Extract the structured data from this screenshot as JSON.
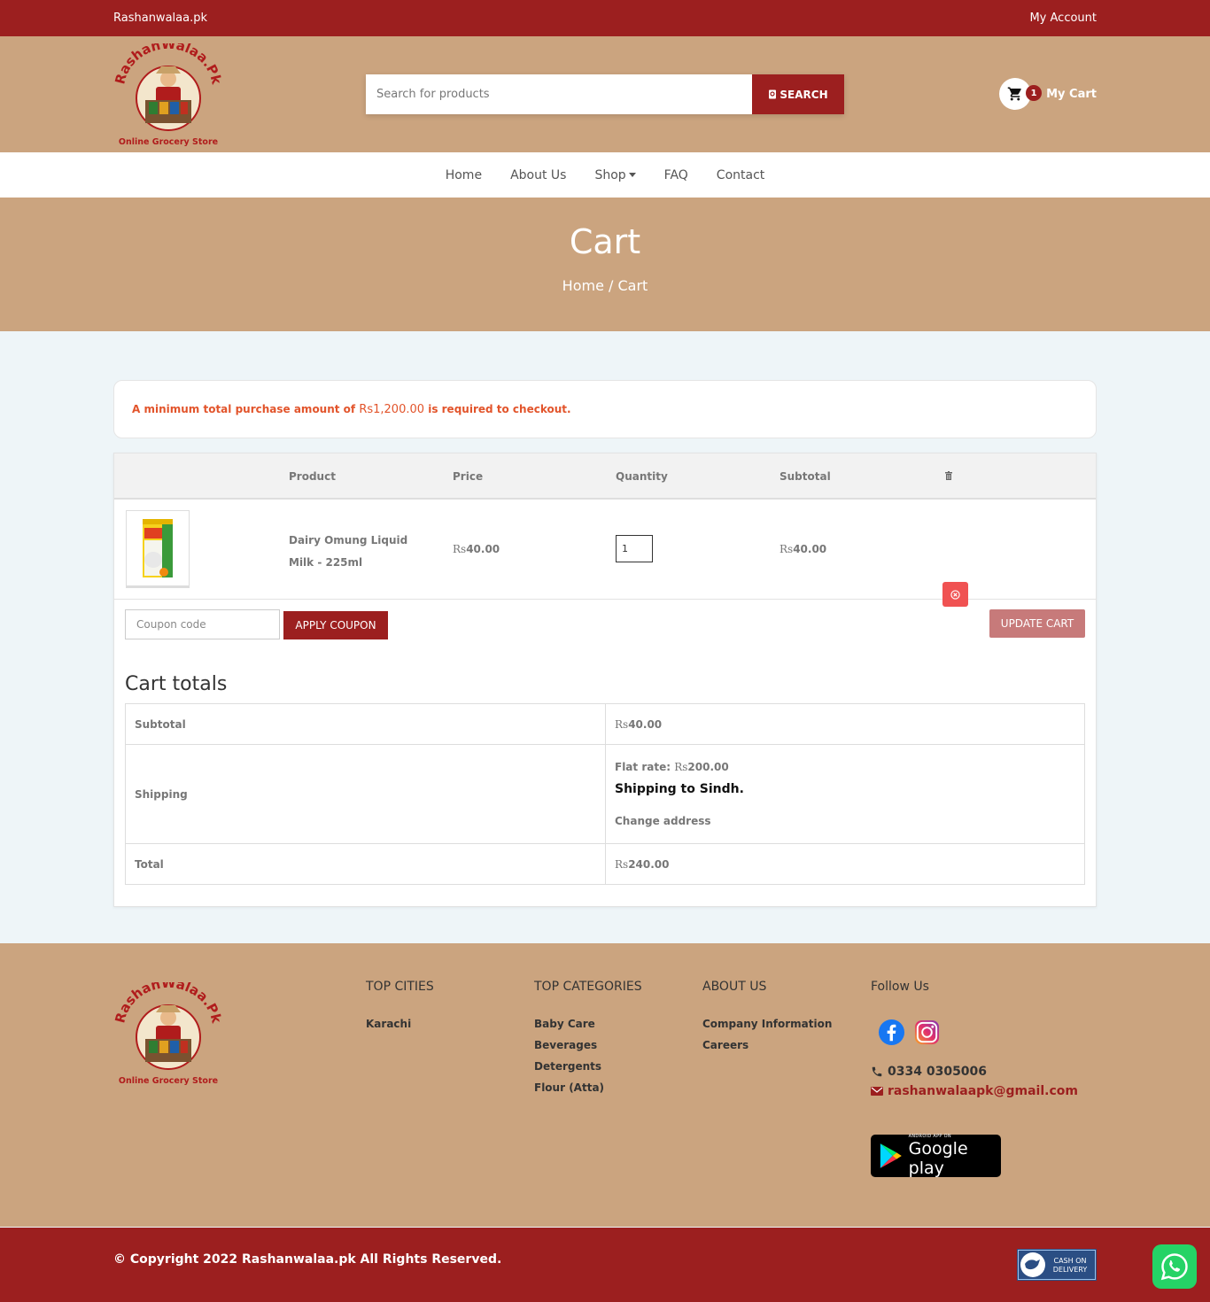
{
  "topbar": {
    "site": "Rashanwalaa.pk",
    "account": "My Account"
  },
  "logo": {
    "text": "RashanWalaa.Pk",
    "tagline": "Online Grocery Store"
  },
  "search": {
    "placeholder": "Search for products",
    "button": "SEARCH"
  },
  "cart": {
    "count": "1",
    "label": "My Cart"
  },
  "nav": {
    "home": "Home",
    "about": "About Us",
    "shop": "Shop",
    "faq": "FAQ",
    "contact": "Contact"
  },
  "banner": {
    "title": "Cart",
    "crumb_home": "Home",
    "crumb_sep": "/",
    "crumb_current": "Cart"
  },
  "notice": {
    "prefix": "A minimum total purchase amount of ",
    "amount": "Rs1,200.00",
    "suffix": " is required to checkout."
  },
  "table": {
    "headers": {
      "product": "Product",
      "price": "Price",
      "quantity": "Quantity",
      "subtotal": "Subtotal"
    },
    "items": [
      {
        "name": "Dairy Omung Liquid Milk - 225ml",
        "price_currency": "Rs",
        "price": "40.00",
        "quantity": "1",
        "subtotal_currency": "Rs",
        "subtotal": "40.00"
      }
    ]
  },
  "coupon": {
    "placeholder": "Coupon code",
    "apply": "APPLY COUPON",
    "update": "UPDATE CART"
  },
  "totals": {
    "title": "Cart totals",
    "subtotal_label": "Subtotal",
    "subtotal_currency": "Rs",
    "subtotal_value": "40.00",
    "shipping_label": "Shipping",
    "flat_rate_label": "Flat rate: ",
    "flat_rate_currency": "Rs",
    "flat_rate_value": "200.00",
    "ship_to": "Shipping to Sindh.",
    "change_address": "Change address",
    "total_label": "Total",
    "total_currency": "Rs",
    "total_value": "240.00"
  },
  "footer": {
    "cities_title": "TOP CITIES",
    "cities": [
      "Karachi"
    ],
    "categories_title": "TOP CATEGORIES",
    "categories": [
      "Baby Care",
      "Beverages",
      "Detergents",
      "Flour (Atta)"
    ],
    "about_title": "ABOUT US",
    "about_links": [
      "Company Information",
      "Careers"
    ],
    "follow_title": "Follow Us",
    "phone": "0334 0305006",
    "email": "rashanwalaapk@gmail.com",
    "gplay_small": "ANDROID APP ON",
    "gplay_big": "Google play"
  },
  "copyright": "© Copyright 2022 Rashanwalaa.pk All Rights Reserved.",
  "cod": {
    "line1": "CASH ON",
    "line2": "DELIVERY"
  },
  "colors": {
    "primary": "#9c1f1f",
    "header_bg": "#cba47f",
    "page_bg": "#eef5f8",
    "notice_text": "#e2542b",
    "remove_btn": "#f05252",
    "whatsapp": "#25d366"
  }
}
